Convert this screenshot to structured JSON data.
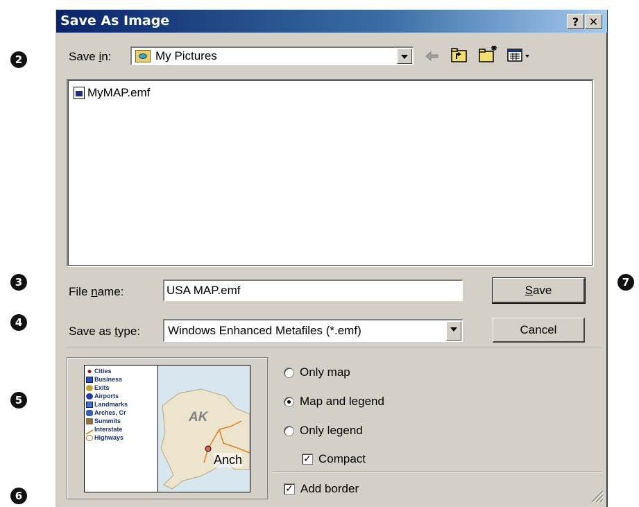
{
  "callouts": [
    "2",
    "3",
    "4",
    "5",
    "6",
    "7"
  ],
  "dialog": {
    "title": "Save As Image",
    "help_button": "?",
    "close_button": "✕"
  },
  "save_in": {
    "label_pre": "Save ",
    "label_accel": "i",
    "label_post": "n:",
    "value": "My Pictures"
  },
  "toolbar_icons": [
    "back-arrow-icon",
    "up-folder-icon",
    "new-folder-icon",
    "view-menu-icon"
  ],
  "files": [
    {
      "name": "MyMAP.emf",
      "icon": "emf-file-icon"
    }
  ],
  "file_name": {
    "label_pre": "File ",
    "label_accel": "n",
    "label_post": "ame:",
    "value": "USA MAP.emf"
  },
  "save_as_type": {
    "label_pre": "Save as ",
    "label_accel": "t",
    "label_post": "ype:",
    "value": "Windows Enhanced Metafiles (*.emf)"
  },
  "buttons": {
    "save_accel": "S",
    "save_rest": "ave",
    "cancel": "Cancel"
  },
  "preview": {
    "legend": [
      "Cities",
      "Business",
      "Exits",
      "Airports",
      "Landmarks",
      "Arches, Cr",
      "Summits",
      "Interstate",
      "Highways"
    ],
    "map_label": "AK",
    "city_label": "Anch"
  },
  "options": {
    "only_map": "Only map",
    "map_and_legend": "Map and legend",
    "only_legend": "Only legend",
    "selected": "Map and legend",
    "compact": "Compact",
    "compact_checked": true,
    "add_border": "Add border",
    "add_border_checked": true
  }
}
